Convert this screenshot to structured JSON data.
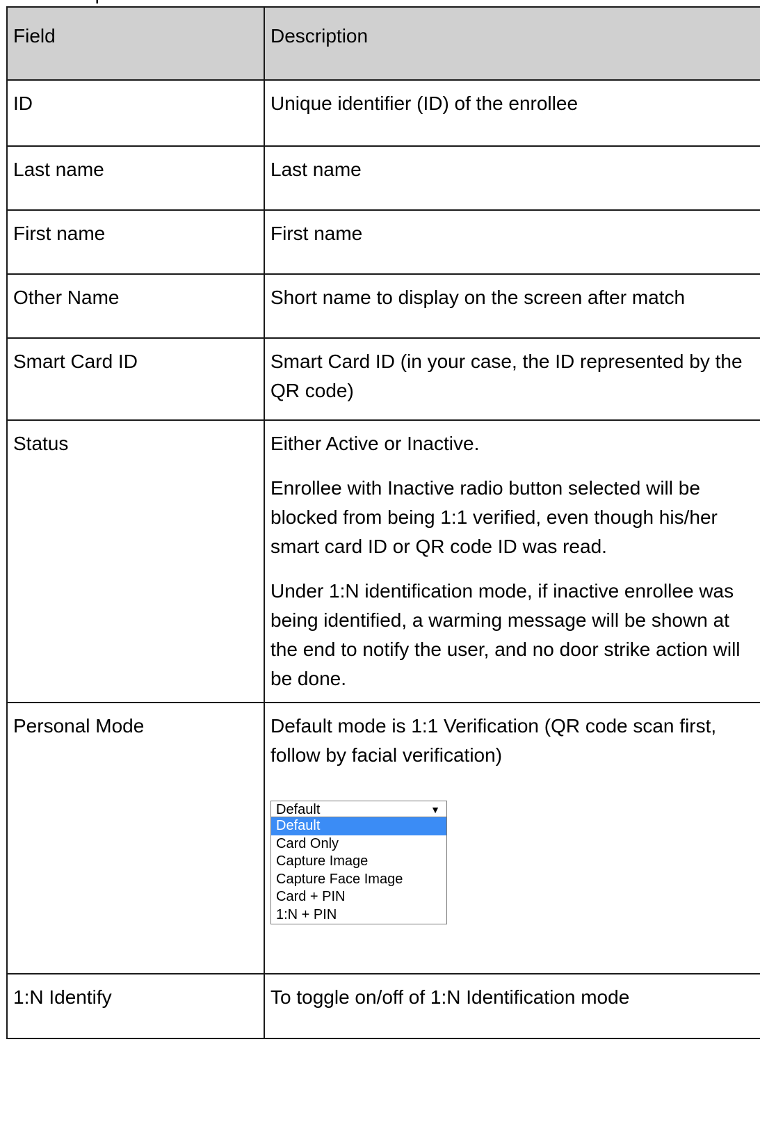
{
  "page_top_fragment": "tion description",
  "table": {
    "headers": {
      "field": "Field",
      "description": "Description"
    },
    "rows": [
      {
        "field": "ID",
        "paragraphs": [
          "Unique identifier (ID) of the enrollee"
        ]
      },
      {
        "field": "Last name",
        "paragraphs": [
          "Last name"
        ]
      },
      {
        "field": "First name",
        "paragraphs": [
          "First name"
        ]
      },
      {
        "field": "Other Name",
        "paragraphs": [
          "Short name to display on the screen after match"
        ]
      },
      {
        "field": "Smart Card ID",
        "paragraphs": [
          "Smart Card ID (in your case, the ID represented by the QR code)"
        ]
      },
      {
        "field": "Status",
        "paragraphs": [
          "Either Active or Inactive.",
          "Enrollee with Inactive radio button selected will be blocked from being 1:1 verified, even though his/her smart card ID or QR code ID was read.",
          "Under 1:N identification mode, if inactive enrollee was being identified, a warming message will be shown at the end to notify the user, and no door strike action will be done."
        ]
      },
      {
        "field": "Personal Mode",
        "paragraphs": [
          "Default mode is 1:1 Verification (QR code scan first, follow by facial verification)"
        ]
      },
      {
        "field": "1:N Identify",
        "paragraphs": [
          "To toggle on/off of 1:N Identification mode"
        ]
      }
    ]
  },
  "personal_mode_dropdown": {
    "selected_value": "Default",
    "arrow_icon": "triangle-down-icon",
    "options": [
      "Default",
      "Card Only",
      "Capture Image",
      "Capture Face Image",
      "Card + PIN",
      "1:N + PIN"
    ],
    "highlighted_index": 0,
    "highlight_color": "#3b8cf5"
  },
  "colors": {
    "header_background": "#d0d0d0",
    "border": "#1a1a1a"
  }
}
